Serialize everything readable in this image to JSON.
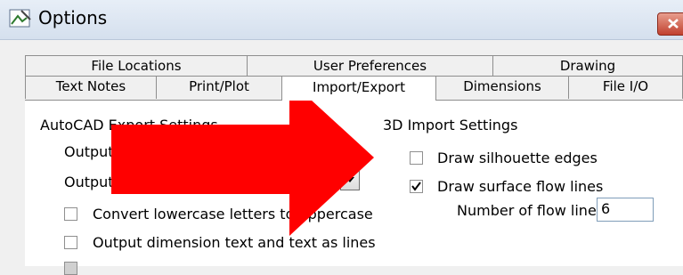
{
  "window": {
    "title": "Options"
  },
  "tabs": {
    "row_top": [
      "File Locations",
      "User Preferences",
      "Drawing"
    ],
    "row_bottom": [
      "Text Notes",
      "Print/Plot",
      "Import/Export",
      "Dimensions",
      "File I/O"
    ],
    "active": "Import/Export"
  },
  "autocad_export": {
    "heading": "AutoCAD Export Settings",
    "field1_label": "Output",
    "field2_label": "Output",
    "checkbox_uppercase": {
      "label": "Convert lowercase letters to uppercase",
      "checked": false
    },
    "checkbox_dimtext": {
      "label": "Output dimension text and text as lines",
      "checked": false
    }
  },
  "import_3d": {
    "heading": "3D Import Settings",
    "silhouette": {
      "label": "Draw silhouette edges",
      "checked": false
    },
    "flowlines": {
      "label": "Draw surface flow lines",
      "checked": true
    },
    "flow_count_label": "Number of flow lines:",
    "flow_count_value": "6"
  },
  "colors": {
    "arrow": "#ff0000",
    "titlebar": "#dbe6f4",
    "close": "#c1412f"
  }
}
